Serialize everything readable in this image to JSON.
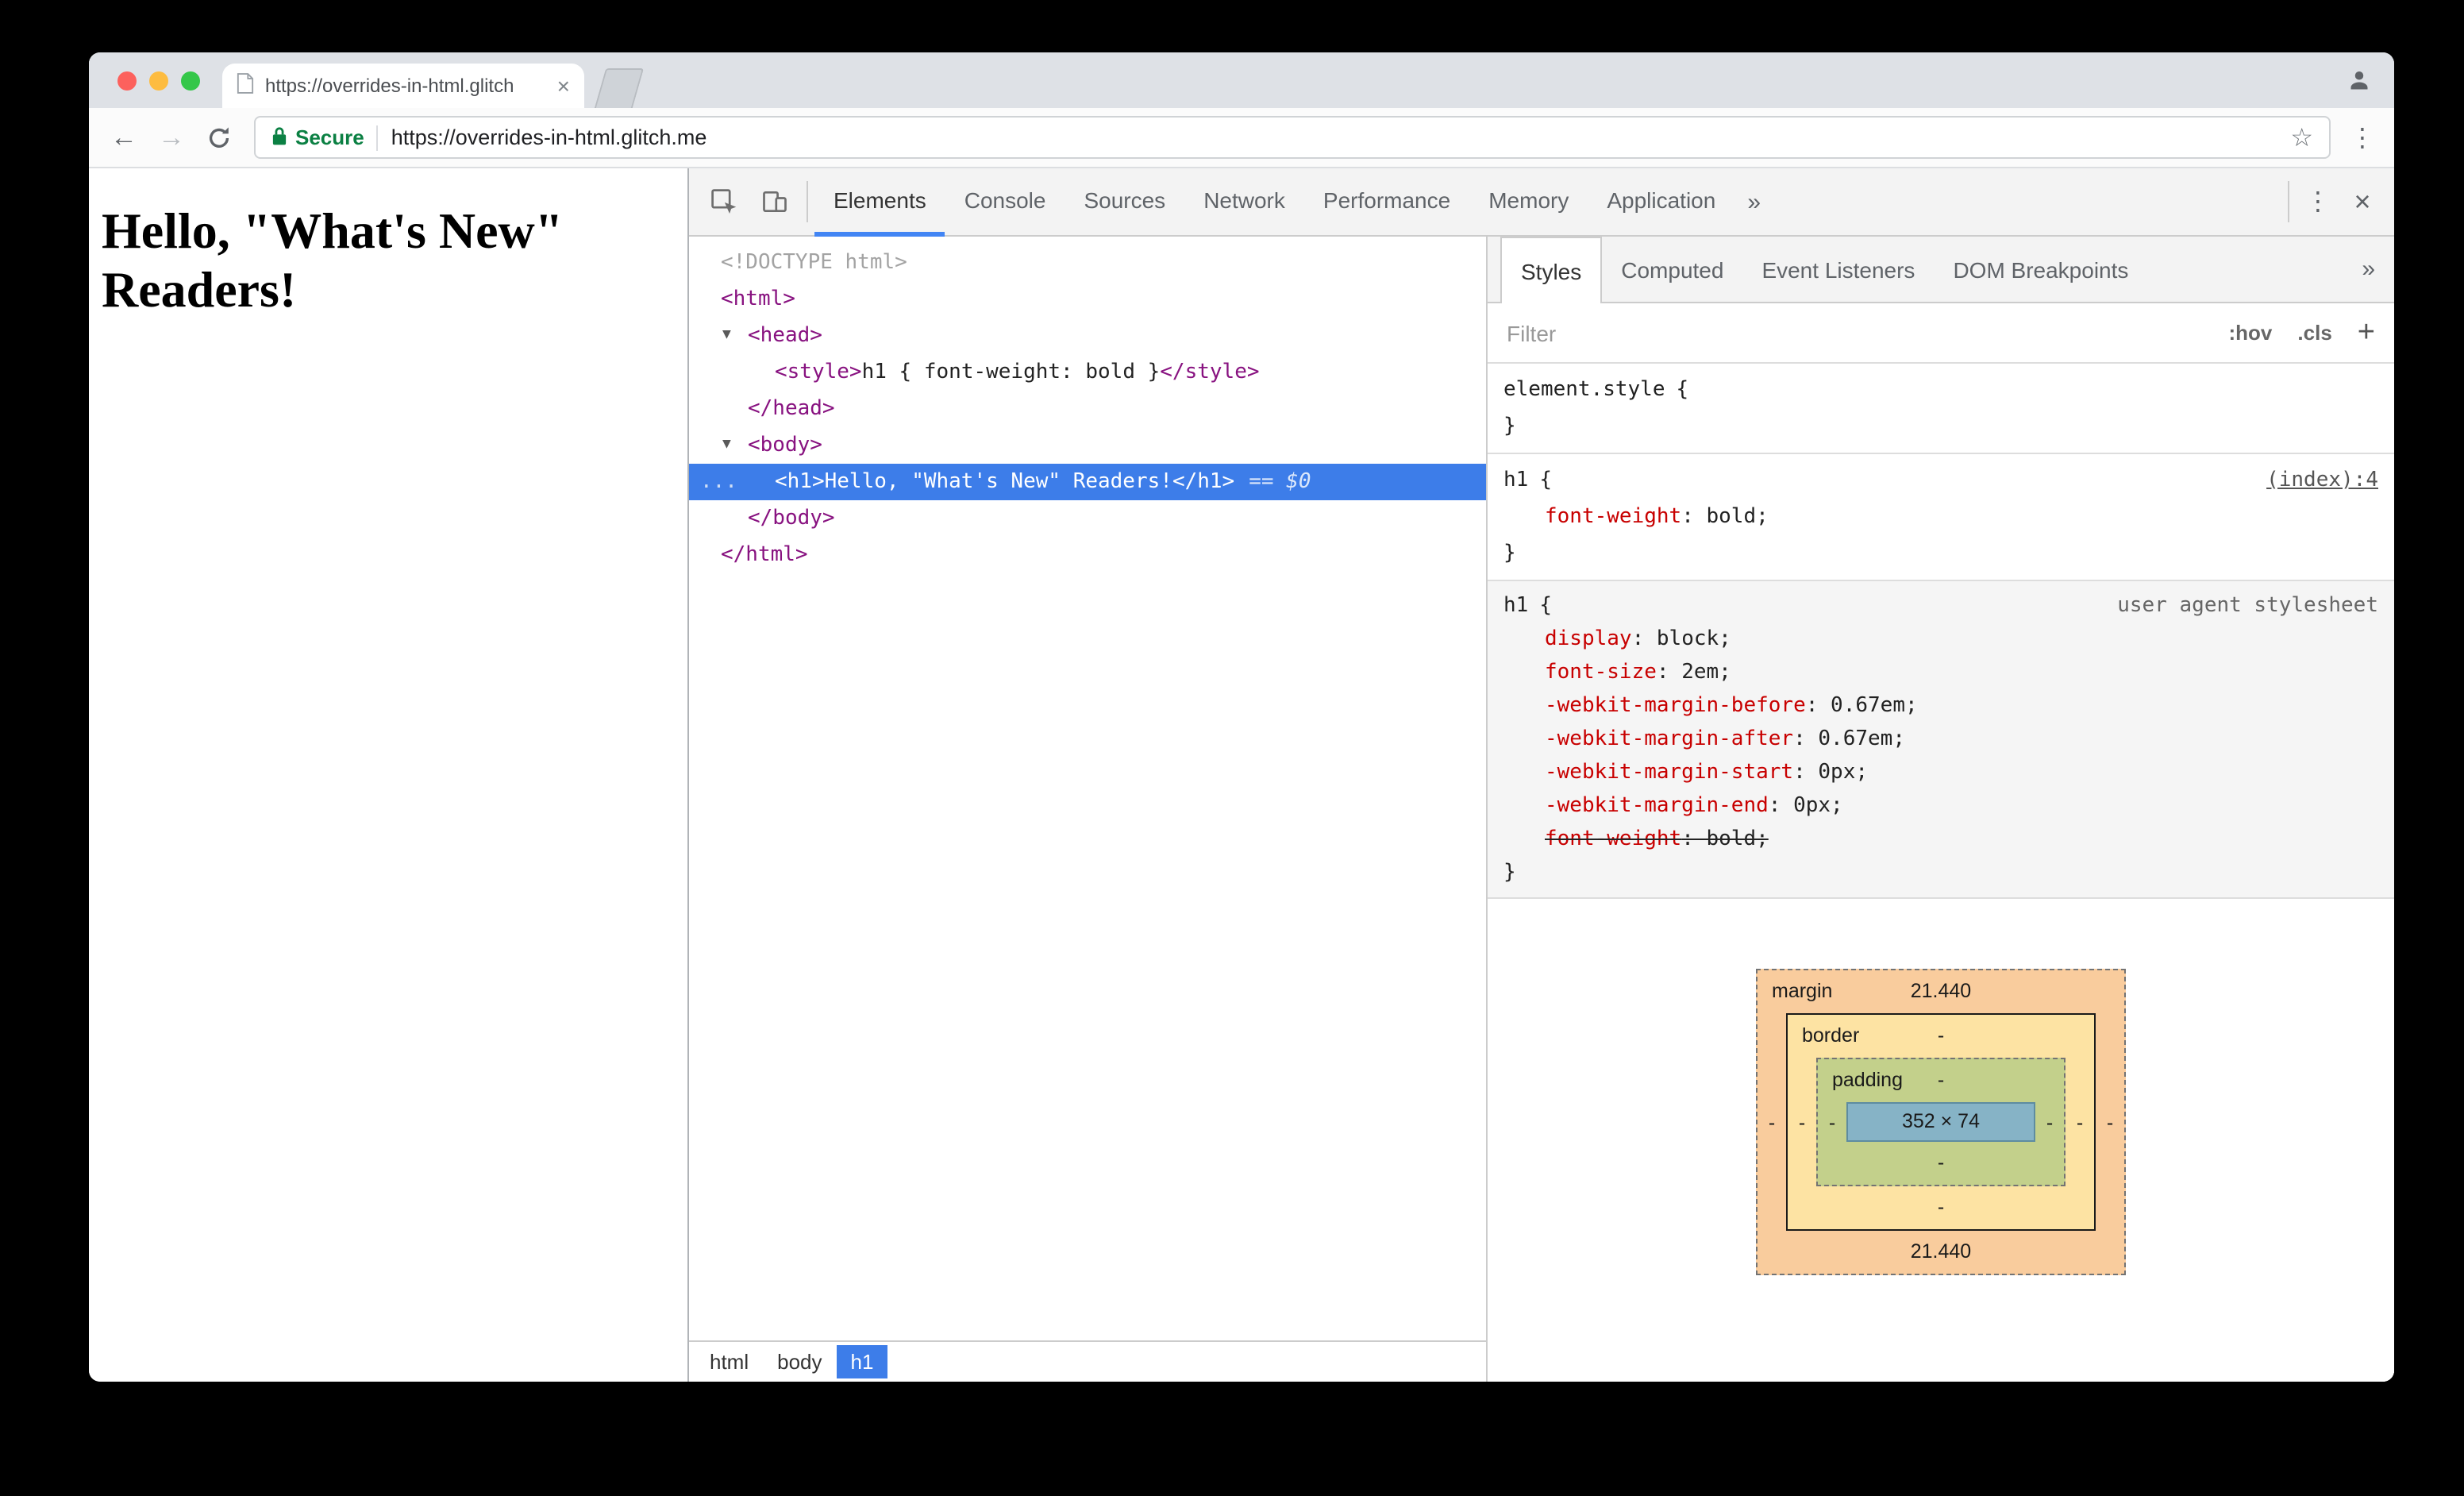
{
  "browser": {
    "tab_title": "https://overrides-in-html.glitch",
    "tab_close": "×",
    "back_icon": "←",
    "forward_icon": "→",
    "security_label": "Secure",
    "url": "https://overrides-in-html.glitch.me",
    "star_icon": "☆",
    "menu_icon": "⋮"
  },
  "page": {
    "heading": "Hello, \"What's New\" Readers!"
  },
  "devtools": {
    "panel_tabs": [
      "Elements",
      "Console",
      "Sources",
      "Network",
      "Performance",
      "Memory",
      "Application"
    ],
    "more_icon": "»",
    "menu_icon": "⋮",
    "close_icon": "×",
    "dom": {
      "doctype": "<!DOCTYPE html>",
      "arrow": "▼",
      "html_open": "<html>",
      "head_open": "<head>",
      "style_open": "<style>",
      "style_text": "h1 { font-weight: bold }",
      "style_close": "</style>",
      "head_close": "</head>",
      "body_open": "<body>",
      "ellipsis": "...",
      "h1_open": "<h1>",
      "h1_text": "Hello, \"What's New\" Readers!",
      "h1_close": "</h1>",
      "selected_hint": "== $0",
      "body_close": "</body>",
      "html_close": "</html>"
    },
    "breadcrumb": [
      "html",
      "body",
      "h1"
    ],
    "sidebar_tabs": [
      "Styles",
      "Computed",
      "Event Listeners",
      "DOM Breakpoints"
    ],
    "sidebar_more_icon": "»",
    "filter_placeholder": "Filter",
    "hov_label": ":hov",
    "cls_label": ".cls",
    "add_icon": "+",
    "styles": {
      "brace_open": "{",
      "brace_close": "}",
      "element_style": {
        "selector": "element.style"
      },
      "inline_rule": {
        "selector": "h1",
        "source": "(index):4",
        "props": [
          {
            "name": "font-weight",
            "rest": ": bold;"
          }
        ]
      },
      "ua_rule": {
        "selector": "h1",
        "source": "user agent stylesheet",
        "props": [
          {
            "name": "display",
            "rest": ": block;"
          },
          {
            "name": "font-size",
            "rest": ": 2em;"
          },
          {
            "name": "-webkit-margin-before",
            "rest": ": 0.67em;"
          },
          {
            "name": "-webkit-margin-after",
            "rest": ": 0.67em;"
          },
          {
            "name": "-webkit-margin-start",
            "rest": ": 0px;"
          },
          {
            "name": "-webkit-margin-end",
            "rest": ": 0px;"
          },
          {
            "name": "font-weight",
            "rest": ": bold;",
            "struck": true
          }
        ]
      }
    },
    "box_model": {
      "margin_label": "margin",
      "border_label": "border",
      "padding_label": "padding",
      "margin_top": "21.440",
      "margin_bottom": "21.440",
      "margin_left": "-",
      "margin_right": "-",
      "border_top": "-",
      "border_bottom": "-",
      "border_left": "-",
      "border_right": "-",
      "padding_top": "-",
      "padding_bottom": "-",
      "padding_left": "-",
      "padding_right": "-",
      "content": "352 × 74"
    },
    "colors": {
      "selection_blue": "#3d7de9",
      "tab_underline": "#4285f4",
      "tag_purple": "#881280",
      "property_red": "#c80000",
      "secure_green": "#0b8043",
      "box_margin": "#f9cc9d",
      "box_border": "#fde3a3",
      "box_padding": "#c3d08b",
      "box_content": "#86b3c6"
    }
  }
}
